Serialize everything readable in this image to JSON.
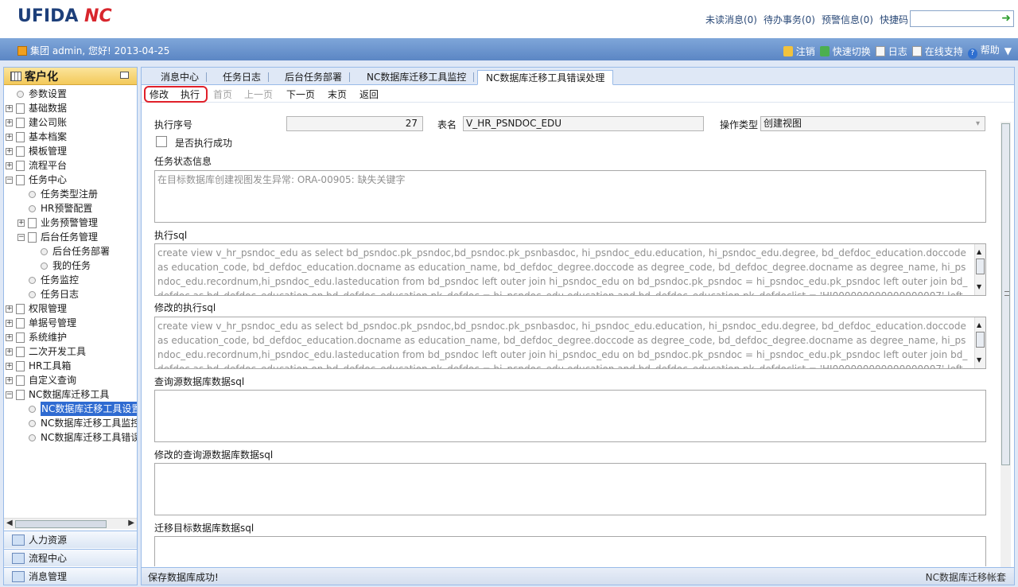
{
  "header": {
    "logo_text": "UFIDA",
    "logo_mark": "NC",
    "links": [
      "未读消息(0)",
      "待办事务(0)",
      "预警信息(0)",
      "快捷码"
    ],
    "quick_code_value": "",
    "go_icon": "arrow-right-icon"
  },
  "userbar": {
    "greeting": "集团 admin, 您好! 2013-04-25",
    "links": [
      "注销",
      "快速切换",
      "日志",
      "在线支持",
      "帮助"
    ]
  },
  "sidebar": {
    "title": "客户化",
    "tree": [
      {
        "label": "参数设置",
        "type": "leaf",
        "level": 0
      },
      {
        "label": "基础数据",
        "type": "collapsed",
        "level": 0
      },
      {
        "label": "建公司账",
        "type": "collapsed",
        "level": 0
      },
      {
        "label": "基本档案",
        "type": "collapsed",
        "level": 0
      },
      {
        "label": "模板管理",
        "type": "collapsed",
        "level": 0
      },
      {
        "label": "流程平台",
        "type": "collapsed",
        "level": 0
      },
      {
        "label": "任务中心",
        "type": "expanded",
        "level": 0
      },
      {
        "label": "任务类型注册",
        "type": "leaf",
        "level": 1
      },
      {
        "label": "HR预警配置",
        "type": "leaf",
        "level": 1
      },
      {
        "label": "业务预警管理",
        "type": "collapsed",
        "level": 1
      },
      {
        "label": "后台任务管理",
        "type": "expanded",
        "level": 1
      },
      {
        "label": "后台任务部署",
        "type": "leaf",
        "level": 2
      },
      {
        "label": "我的任务",
        "type": "leaf",
        "level": 2
      },
      {
        "label": "任务监控",
        "type": "leaf",
        "level": 1
      },
      {
        "label": "任务日志",
        "type": "leaf",
        "level": 1
      },
      {
        "label": "权限管理",
        "type": "collapsed",
        "level": 0
      },
      {
        "label": "单据号管理",
        "type": "collapsed",
        "level": 0
      },
      {
        "label": "系统维护",
        "type": "collapsed",
        "level": 0
      },
      {
        "label": "二次开发工具",
        "type": "collapsed",
        "level": 0
      },
      {
        "label": "HR工具箱",
        "type": "collapsed",
        "level": 0
      },
      {
        "label": "自定义查询",
        "type": "collapsed",
        "level": 0
      },
      {
        "label": "NC数据库迁移工具",
        "type": "expanded",
        "level": 0
      },
      {
        "label": "NC数据库迁移工具设置",
        "type": "leaf",
        "level": 1,
        "selected": true
      },
      {
        "label": "NC数据库迁移工具监控",
        "type": "leaf",
        "level": 1
      },
      {
        "label": "NC数据库迁移工具错误处理",
        "type": "leaf",
        "level": 1
      }
    ],
    "modules": [
      "人力资源",
      "流程中心",
      "消息管理"
    ]
  },
  "tabs": [
    "消息中心",
    "任务日志",
    "后台任务部署",
    "NC数据库迁移工具监控",
    "NC数据库迁移工具错误处理"
  ],
  "toolbar": {
    "modify": "修改",
    "execute": "执行",
    "first": "首页",
    "prev": "上一页",
    "next": "下一页",
    "last": "末页",
    "back": "返回"
  },
  "form": {
    "seq_label": "执行序号",
    "seq_value": "27",
    "table_label": "表名",
    "table_value": "V_HR_PSNDOC_EDU",
    "optype_label": "操作类型",
    "optype_value": "创建视图",
    "success_label": "是否执行成功",
    "status_label": "任务状态信息",
    "status_value": "在目标数据库创建视图发生异常: ORA-00905: 缺失关键字",
    "exec_sql_label": "执行sql",
    "exec_sql_value": "create view v_hr_psndoc_edu as select bd_psndoc.pk_psndoc,bd_psndoc.pk_psnbasdoc, hi_psndoc_edu.education, hi_psndoc_edu.degree, bd_defdoc_education.doccode as education_code, bd_defdoc_education.docname as education_name, bd_defdoc_degree.doccode as degree_code, bd_defdoc_degree.docname as degree_name, hi_psndoc_edu.recordnum,hi_psndoc_edu.lasteducation from bd_psndoc left outer join hi_psndoc_edu on bd_psndoc.pk_psndoc = hi_psndoc_edu.pk_psndoc left outer join bd_defdoc as bd_defdoc_education on bd_defdoc_education.pk_defdoc = hi_psndoc_edu.education and bd_defdoc_education.pk_defdoclist = 'HI000000000000000007' left outer join bd_defdoc as bd_defdoc_degree on bd_d",
    "mod_sql_label": "修改的执行sql",
    "mod_sql_value": "create view v_hr_psndoc_edu as select bd_psndoc.pk_psndoc,bd_psndoc.pk_psnbasdoc, hi_psndoc_edu.education, hi_psndoc_edu.degree, bd_defdoc_education.doccode as education_code, bd_defdoc_education.docname as education_name, bd_defdoc_degree.doccode as degree_code, bd_defdoc_degree.docname as degree_name, hi_psndoc_edu.recordnum,hi_psndoc_edu.lasteducation from bd_psndoc left outer join hi_psndoc_edu on bd_psndoc.pk_psndoc = hi_psndoc_edu.pk_psndoc left outer join bd_defdoc as bd_defdoc_education on bd_defdoc_education.pk_defdoc = hi_psndoc_edu.education and bd_defdoc_education.pk_defdoclist = 'HI000000000000000007' left outer join bd_defdoc as bd_defdoc_degree on bd_d",
    "src_sql_label": "查询源数据库数据sql",
    "mod_src_sql_label": "修改的查询源数据库数据sql",
    "target_sql_label": "迁移目标数据库数据sql"
  },
  "status": {
    "message": "保存数据库成功!",
    "right": "NC数据库迁移帐套"
  }
}
